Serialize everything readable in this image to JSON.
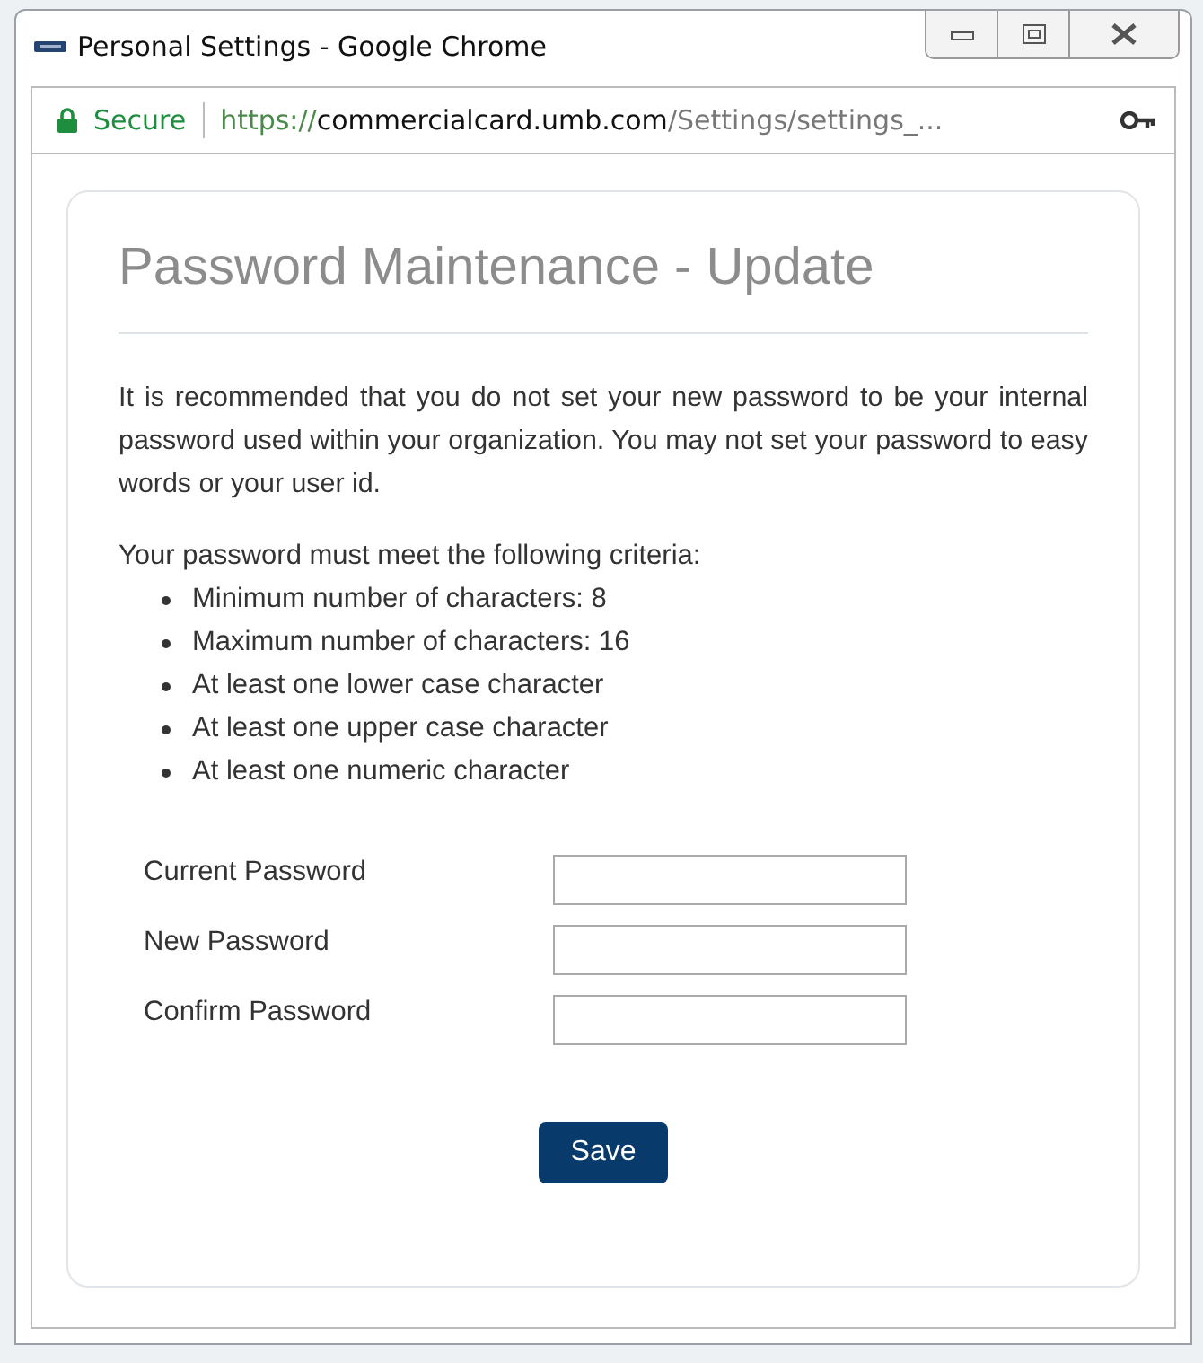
{
  "window": {
    "title": "Personal Settings - Google Chrome"
  },
  "address_bar": {
    "security": "Secure",
    "url_scheme": "https://",
    "url_host": "commercialcard.umb.com",
    "url_path": "/Settings/settings_..."
  },
  "page": {
    "heading": "Password Maintenance - Update",
    "intro": "It is recommended that you do not set your new password to be your internal password used within your organization. You may not set your password to easy words or your user id.",
    "criteria_title": "Your password must meet the following criteria:",
    "criteria": [
      "Minimum number of characters: 8",
      "Maximum number of characters: 16",
      "At least one lower case character",
      "At least one upper case character",
      "At least one numeric character"
    ],
    "fields": [
      {
        "label": "Current Password"
      },
      {
        "label": "New Password"
      },
      {
        "label": "Confirm Password"
      }
    ],
    "save_button": "Save"
  }
}
